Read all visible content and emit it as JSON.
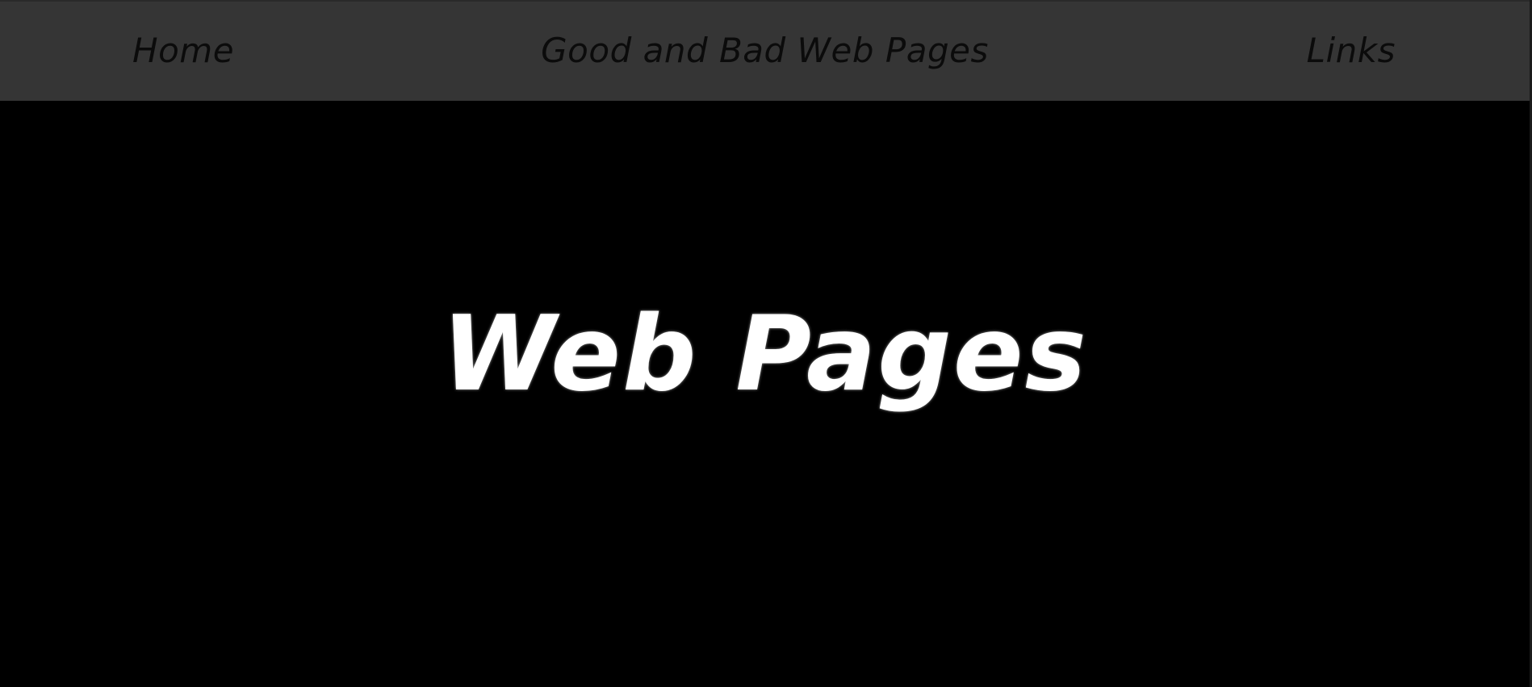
{
  "nav": {
    "home_label": "Home",
    "site_title": "Good and Bad Web Pages",
    "links_label": "Links"
  },
  "hero": {
    "title": "Web Pages"
  },
  "colors": {
    "nav_background": "#353535",
    "nav_text": "#0b0b0b",
    "page_background": "#000000",
    "hero_text": "#ffffff"
  }
}
